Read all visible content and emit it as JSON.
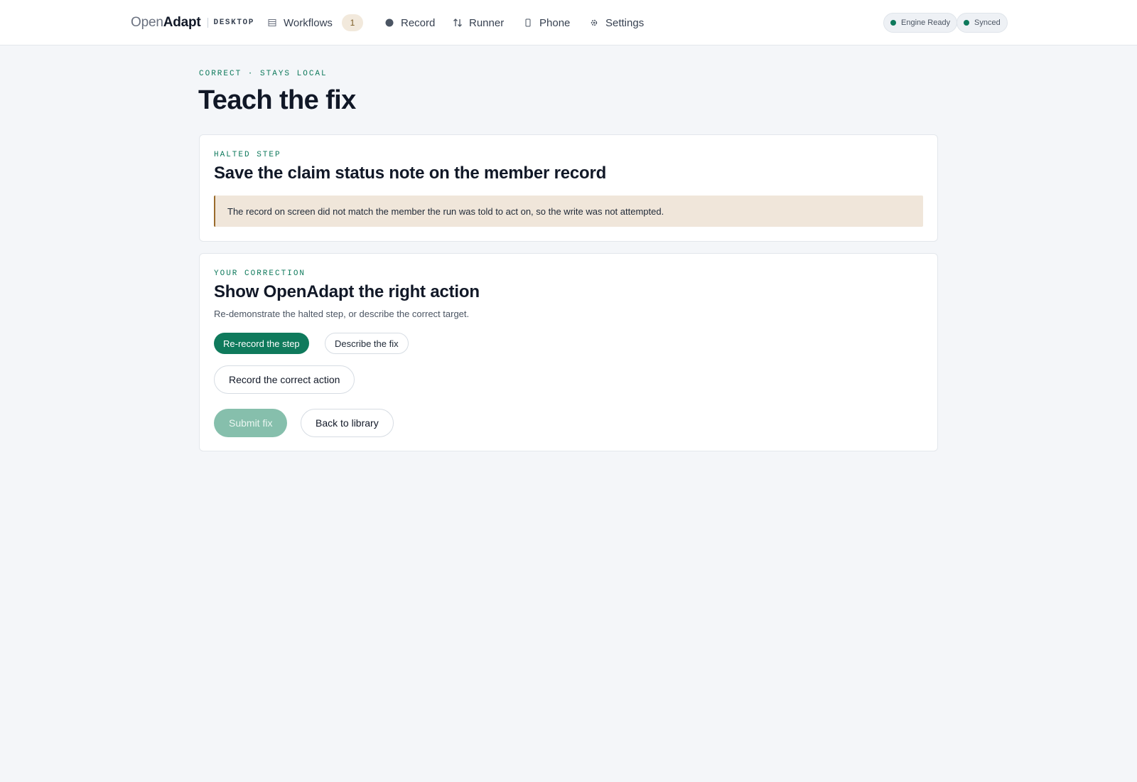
{
  "brand": {
    "open": "Open",
    "adapt": "Adapt",
    "tag": "DESKTOP"
  },
  "nav": {
    "workflows": {
      "label": "Workflows",
      "badge": "1",
      "icon": "list-icon"
    },
    "record": {
      "label": "Record",
      "icon": "record-dot-icon"
    },
    "runner": {
      "label": "Runner",
      "icon": "swap-arrows-icon"
    },
    "phone": {
      "label": "Phone",
      "icon": "phone-icon"
    },
    "settings": {
      "label": "Settings",
      "icon": "gear-icon"
    }
  },
  "status": {
    "engine": "Engine Ready",
    "synced": "Synced",
    "color": "#0f7a5c"
  },
  "page": {
    "eyebrow": "CORRECT · STAYS LOCAL",
    "title": "Teach the fix"
  },
  "halted": {
    "eyebrow": "HALTED STEP",
    "title": "Save the claim status note on the member record",
    "alert": "The record on screen did not match the member the run was told to act on, so the write was not attempted."
  },
  "correction": {
    "eyebrow": "YOUR CORRECTION",
    "title": "Show OpenAdapt the right action",
    "description": "Re-demonstrate the halted step, or describe the correct target.",
    "modes": {
      "rerecord": "Re-record the step",
      "describe": "Describe the fix",
      "selected": "Re-record the step"
    },
    "record_button": "Record the correct action",
    "submit_button": "Submit fix",
    "back_button": "Back to library"
  },
  "colors": {
    "accent": "#0f7a5c",
    "accent_disabled": "#86bfac",
    "alert_bg": "#f0e6da",
    "alert_border": "#9a6b2c"
  }
}
